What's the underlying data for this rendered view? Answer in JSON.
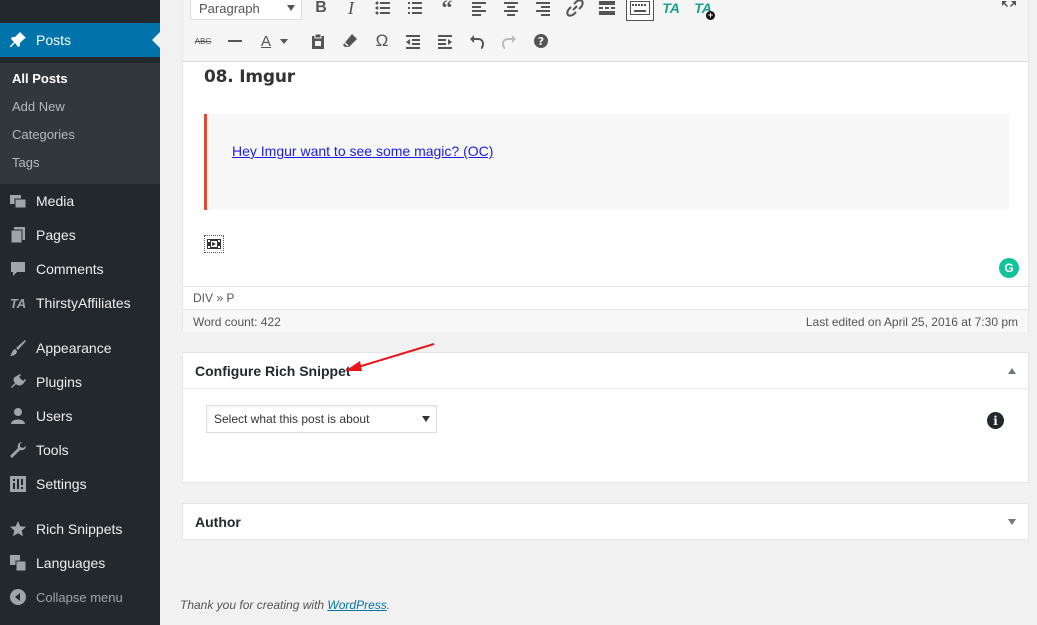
{
  "sidebar": {
    "posts": "Posts",
    "submenu": [
      "All Posts",
      "Add New",
      "Categories",
      "Tags"
    ],
    "items": [
      "Media",
      "Pages",
      "Comments",
      "ThirstyAffiliates",
      "Appearance",
      "Plugins",
      "Users",
      "Tools",
      "Settings",
      "Rich Snippets",
      "Languages",
      "Collapse menu"
    ],
    "ta_logo": "TA"
  },
  "toolbar": {
    "format_value": "Paragraph",
    "ta_label": "TA",
    "strike_label": "ABC",
    "text_color_label": "A",
    "omega_label": "Ω"
  },
  "editor": {
    "heading": "08. Imgur",
    "quote_link": "Hey Imgur want to see some magic? (OC)",
    "grammarly_label": "G",
    "path": "DIV » P",
    "word_count": "Word count: 422",
    "last_edited": "Last edited on April 25, 2016 at 7:30 pm"
  },
  "snippet": {
    "title": "Configure Rich Snippet",
    "select_value": "Select what this post is about",
    "info_label": "i"
  },
  "author": {
    "title": "Author"
  },
  "footer": {
    "text": "Thank you for creating with ",
    "link": "WordPress",
    "suffix": "."
  },
  "colors": {
    "sidebar_bg": "#23282d",
    "active_bg": "#0073aa",
    "quote_border": "#dd4b39",
    "annotation_arrow": "#e8151b",
    "grammarly": "#15c39a"
  }
}
